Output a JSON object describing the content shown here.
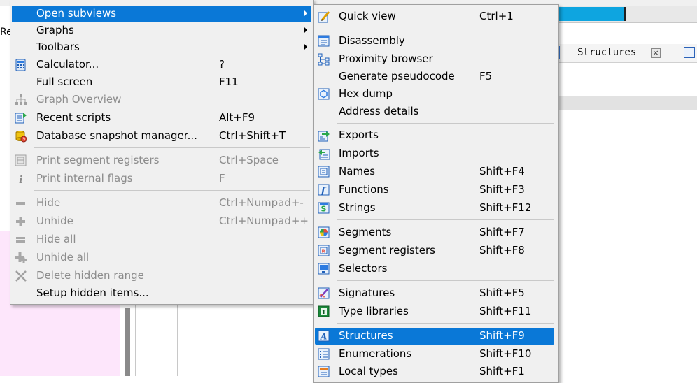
{
  "background": {
    "left_label": "Re",
    "structures_tab_label": "Structures",
    "structures_tab_close": "×",
    "progress_fraction": 0.5
  },
  "left_menu": {
    "items": [
      {
        "label": "Open subviews",
        "shortcut": "",
        "submenu": true,
        "selected": true
      },
      {
        "label": "Graphs",
        "shortcut": "",
        "submenu": true
      },
      {
        "label": "Toolbars",
        "shortcut": "",
        "submenu": true
      },
      {
        "label": "Calculator...",
        "shortcut": "?",
        "icon": "calculator-icon"
      },
      {
        "label": "Full screen",
        "shortcut": "F11"
      },
      {
        "label": "Graph Overview",
        "shortcut": "",
        "disabled": true,
        "icon": "graph-overview-icon"
      },
      {
        "label": "Recent scripts",
        "shortcut": "Alt+F9",
        "icon": "recent-scripts-icon"
      },
      {
        "label": "Database snapshot manager...",
        "shortcut": "Ctrl+Shift+T",
        "icon": "snapshot-manager-icon"
      },
      {
        "label": "Print segment registers",
        "shortcut": "Ctrl+Space",
        "disabled": true,
        "icon": "segment-registers-icon"
      },
      {
        "label": "Print internal flags",
        "shortcut": "F",
        "disabled": true,
        "icon": "info-icon"
      },
      {
        "label": "Hide",
        "shortcut": "Ctrl+Numpad+-",
        "disabled": true,
        "icon": "minus-icon"
      },
      {
        "label": "Unhide",
        "shortcut": "Ctrl+Numpad++",
        "disabled": true,
        "icon": "plus-icon"
      },
      {
        "label": "Hide all",
        "shortcut": "",
        "disabled": true,
        "icon": "minus-all-icon"
      },
      {
        "label": "Unhide all",
        "shortcut": "",
        "disabled": true,
        "icon": "plus-all-icon"
      },
      {
        "label": "Delete hidden range",
        "shortcut": "",
        "disabled": true,
        "icon": "delete-x-icon"
      },
      {
        "label": "Setup hidden items...",
        "shortcut": ""
      }
    ]
  },
  "right_menu": {
    "items": [
      {
        "label": "Quick view",
        "shortcut": "Ctrl+1",
        "icon": "quick-view-icon"
      },
      {
        "label": "Disassembly",
        "shortcut": "",
        "icon": "disassembly-icon"
      },
      {
        "label": "Proximity browser",
        "shortcut": "",
        "icon": "proximity-browser-icon"
      },
      {
        "label": "Generate pseudocode",
        "shortcut": "F5"
      },
      {
        "label": "Hex dump",
        "shortcut": "",
        "icon": "hex-dump-icon"
      },
      {
        "label": "Address details",
        "shortcut": ""
      },
      {
        "label": "Exports",
        "shortcut": "",
        "icon": "exports-icon"
      },
      {
        "label": "Imports",
        "shortcut": "",
        "icon": "imports-icon"
      },
      {
        "label": "Names",
        "shortcut": "Shift+F4",
        "icon": "names-icon"
      },
      {
        "label": "Functions",
        "shortcut": "Shift+F3",
        "icon": "functions-icon"
      },
      {
        "label": "Strings",
        "shortcut": "Shift+F12",
        "icon": "strings-icon"
      },
      {
        "label": "Segments",
        "shortcut": "Shift+F7",
        "icon": "segments-icon"
      },
      {
        "label": "Segment registers",
        "shortcut": "Shift+F8",
        "icon": "segment-registers-icon"
      },
      {
        "label": "Selectors",
        "shortcut": "",
        "icon": "selectors-icon"
      },
      {
        "label": "Signatures",
        "shortcut": "Shift+F5",
        "icon": "signatures-icon"
      },
      {
        "label": "Type libraries",
        "shortcut": "Shift+F11",
        "icon": "type-libraries-icon"
      },
      {
        "label": "Structures",
        "shortcut": "Shift+F9",
        "icon": "structures-icon",
        "selected": true
      },
      {
        "label": "Enumerations",
        "shortcut": "Shift+F10",
        "icon": "enumerations-icon"
      },
      {
        "label": "Local types",
        "shortcut": "Shift+F1",
        "icon": "local-types-icon"
      }
    ]
  }
}
